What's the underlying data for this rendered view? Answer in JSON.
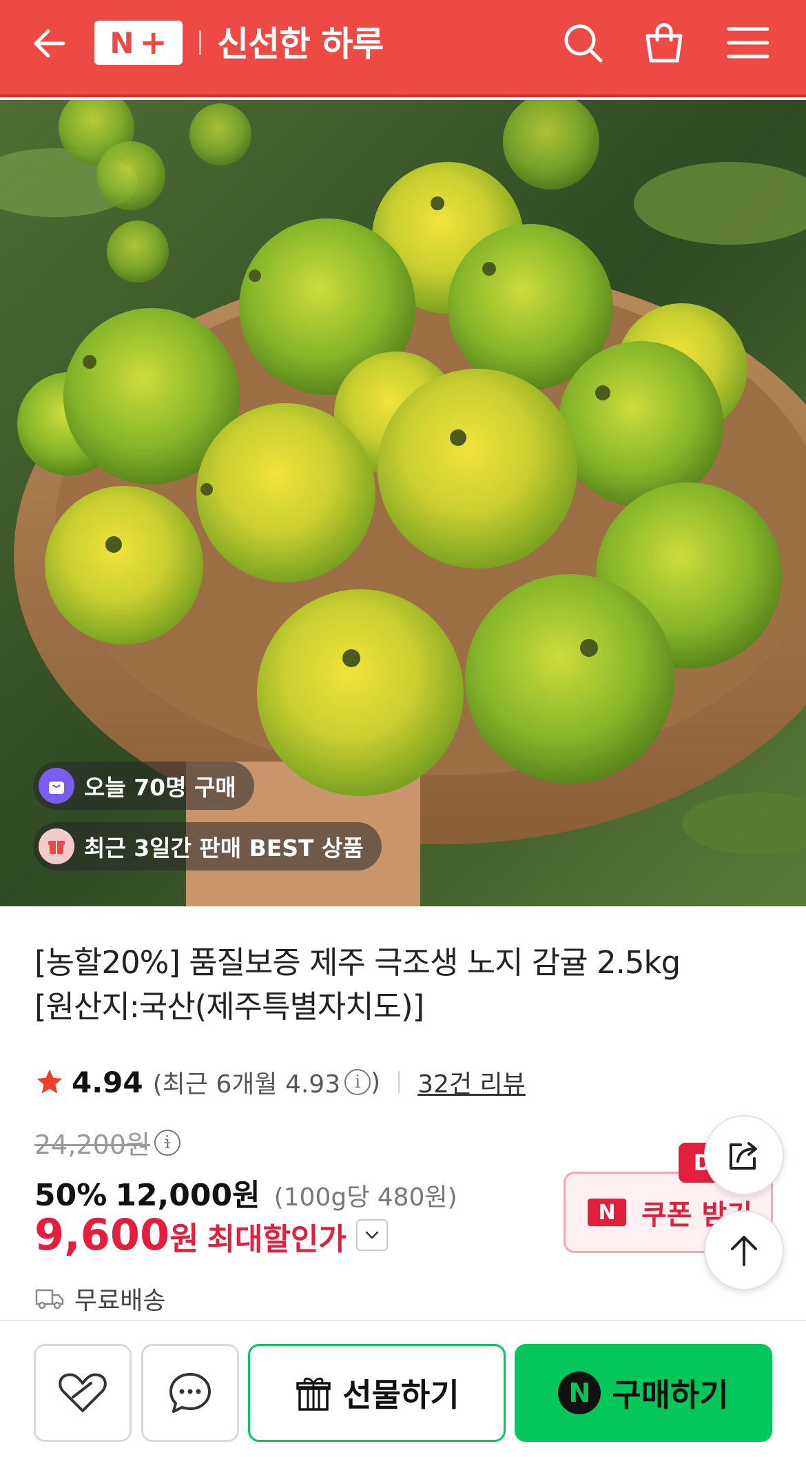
{
  "header": {
    "logo_n": "N",
    "logo_plus": "+",
    "title": "신선한 하루",
    "icons": [
      "back-arrow-icon",
      "search-icon",
      "shopping-bag-icon",
      "menu-icon"
    ],
    "background": "#ee4a45"
  },
  "hero": {
    "badges": [
      {
        "icon": "bag-icon",
        "text": "오늘 70명 구매"
      },
      {
        "icon": "gift-icon",
        "text": "최근 3일간 판매 BEST 상품"
      }
    ]
  },
  "product": {
    "title_line1": "[농할20%] 품질보증 제주 극조생 노지 감귤 2.5kg",
    "title_line2": "[원산지:국산(제주특별자치도)]",
    "rating": "4.94",
    "recent_rating": "(최근 6개월 4.93",
    "recent_rating_close": ")",
    "review_count": "32건 리뷰",
    "original_price": "24,200원",
    "discount_rate": "50%",
    "price": "12,000원",
    "unit_price": "(100g당 480원)",
    "max_price_number": "9,600",
    "max_price_won": "원",
    "max_price_label": "최대할인가",
    "shipping": "무료배송"
  },
  "coupon": {
    "tag": "D",
    "n_label": "N",
    "label": "쿠폰 받기"
  },
  "bottom": {
    "gift_label": "선물하기",
    "buy_n": "N",
    "buy_label": "구매하기"
  },
  "colors": {
    "brand_red": "#ee4a45",
    "sale_red": "#e61e3d",
    "naver_green": "#03c75a"
  }
}
